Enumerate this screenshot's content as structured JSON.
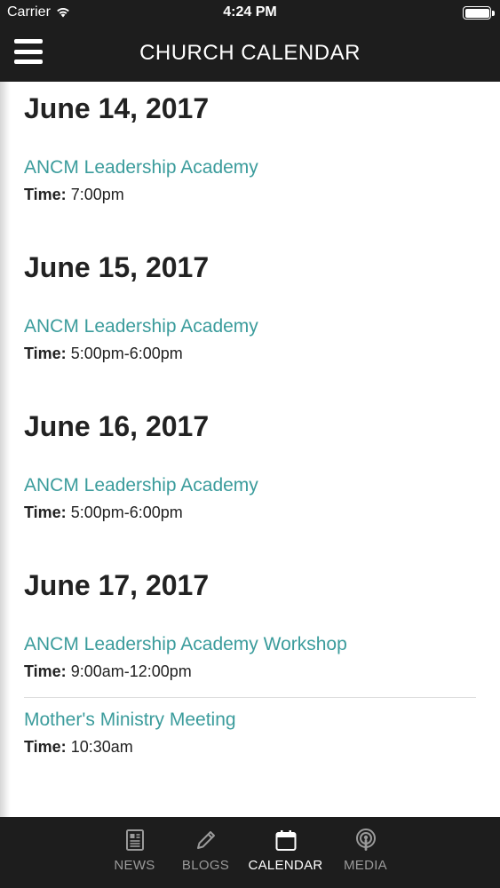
{
  "status_bar": {
    "carrier": "Carrier",
    "time": "4:24 PM"
  },
  "header": {
    "title": "CHURCH CALENDAR",
    "menu_icon": "hamburger-menu-icon"
  },
  "days": [
    {
      "date": "June 14, 2017",
      "events": [
        {
          "title": "ANCM Leadership Academy",
          "time_label": "Time:",
          "time": "7:00pm"
        }
      ]
    },
    {
      "date": "June 15, 2017",
      "events": [
        {
          "title": "ANCM Leadership Academy",
          "time_label": "Time:",
          "time": "5:00pm-6:00pm"
        }
      ]
    },
    {
      "date": "June 16, 2017",
      "events": [
        {
          "title": "ANCM Leadership Academy",
          "time_label": "Time:",
          "time": "5:00pm-6:00pm"
        }
      ]
    },
    {
      "date": "June 17, 2017",
      "events": [
        {
          "title": "ANCM Leadership Academy Workshop",
          "time_label": "Time:",
          "time": "9:00am-12:00pm"
        },
        {
          "title": "Mother's Ministry Meeting",
          "time_label": "Time:",
          "time": "10:30am"
        }
      ]
    }
  ],
  "tabs": [
    {
      "label": "NEWS",
      "icon": "newspaper-icon",
      "active": false
    },
    {
      "label": "BLOGS",
      "icon": "pencil-icon",
      "active": false
    },
    {
      "label": "CALENDAR",
      "icon": "calendar-icon",
      "active": true
    },
    {
      "label": "MEDIA",
      "icon": "podcast-icon",
      "active": false
    }
  ],
  "colors": {
    "bar": "#1d1d1d",
    "link": "#3b9c9c",
    "tab_inactive": "#9a9a9a"
  }
}
